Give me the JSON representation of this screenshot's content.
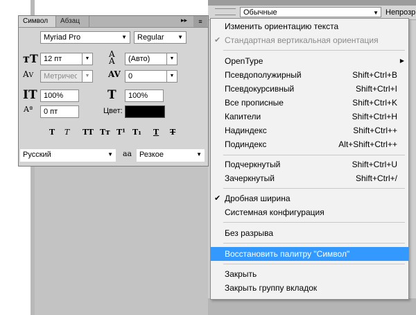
{
  "right_panel": {
    "font_style_value": "Обычные",
    "opacity_label": "Непрозр"
  },
  "character_panel": {
    "tabs": [
      "Символ",
      "Абзац"
    ],
    "collapse_glyph": "▸▸",
    "menu_glyph": "≡",
    "font_family": "Myriad Pro",
    "font_style": "Regular",
    "font_size": "12 пт",
    "leading": "(Авто)",
    "kerning": "Метрический",
    "tracking": "0",
    "vertical_scale": "100%",
    "horizontal_scale": "100%",
    "baseline_shift": "0 пт",
    "color_label": "Цвет:",
    "color_value": "#000000",
    "style_buttons": [
      "T",
      "T",
      "TT",
      "Tт",
      "T¹",
      "T₁",
      "T",
      "T"
    ],
    "language": "Русский",
    "anti_alias_icon_text": "aa",
    "anti_alias": "Резкое"
  },
  "menu": {
    "items": [
      {
        "label": "Изменить ориентацию текста",
        "shortcut": "",
        "checked": false,
        "disabled": false
      },
      {
        "label": "Стандартная вертикальная ориентация",
        "shortcut": "",
        "checked": true,
        "disabled": true
      },
      {
        "label": "OpenType",
        "shortcut": "",
        "checked": false,
        "disabled": false,
        "submenu": true
      },
      {
        "label": "Псевдополужирный",
        "shortcut": "Shift+Ctrl+B"
      },
      {
        "label": "Псевдокурсивный",
        "shortcut": "Shift+Ctrl+I"
      },
      {
        "label": "Все прописные",
        "shortcut": "Shift+Ctrl+K"
      },
      {
        "label": "Капители",
        "shortcut": "Shift+Ctrl+H"
      },
      {
        "label": "Надиндекс",
        "shortcut": "Shift+Ctrl++"
      },
      {
        "label": "Подиндекс",
        "shortcut": "Alt+Shift+Ctrl++"
      },
      {
        "label": "Подчеркнутый",
        "shortcut": "Shift+Ctrl+U"
      },
      {
        "label": "Зачеркнутый",
        "shortcut": "Shift+Ctrl+/"
      },
      {
        "label": "Дробная ширина",
        "shortcut": "",
        "checked": true
      },
      {
        "label": "Системная конфигурация",
        "shortcut": ""
      },
      {
        "label": "Без разрыва",
        "shortcut": ""
      },
      {
        "label": "Восстановить палитру \"Символ\"",
        "shortcut": "",
        "highlighted": true
      },
      {
        "label": "Закрыть",
        "shortcut": ""
      },
      {
        "label": "Закрыть группу вкладок",
        "shortcut": ""
      }
    ],
    "check_glyph": "✔",
    "submenu_glyph": "▶",
    "highlight_color": "#3399ff"
  }
}
